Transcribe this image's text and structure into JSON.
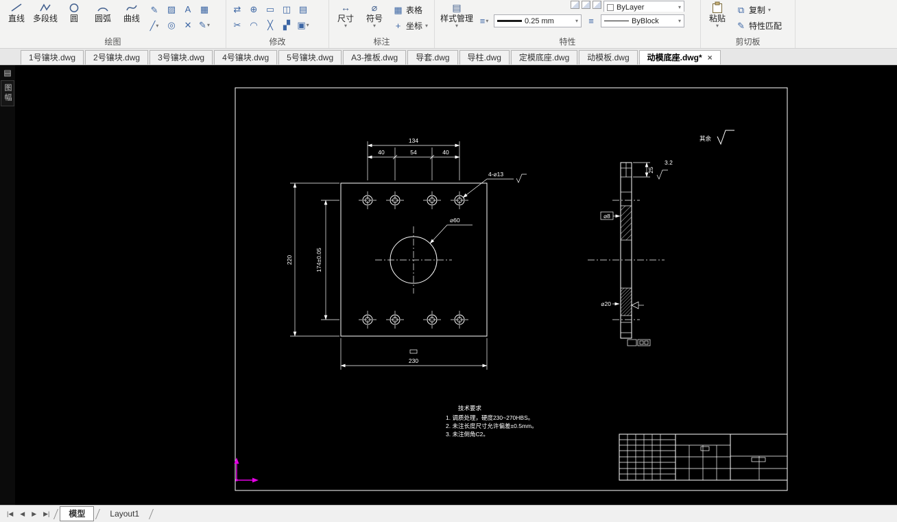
{
  "ribbon": {
    "draw": {
      "label": "绘图",
      "line": "直线",
      "polyline": "多段线",
      "circle": "圆",
      "arc": "圆弧",
      "spline": "曲线"
    },
    "modify": {
      "label": "修改"
    },
    "annotate": {
      "label": "标注",
      "dimension": "尺寸",
      "symbol": "符号",
      "table": "表格",
      "coordinate": "坐标"
    },
    "properties": {
      "label": "特性",
      "style_manager": "样式管理",
      "color": "ByLayer",
      "lineweight": "0.25 mm",
      "linetype": "ByBlock"
    },
    "clipboard": {
      "label": "剪切板",
      "paste": "粘贴",
      "copy": "复制",
      "match_properties": "特性匹配"
    }
  },
  "doc_tabs": {
    "close_glyph": "×",
    "items": [
      {
        "label": "1号镶块.dwg"
      },
      {
        "label": "2号镶块.dwg"
      },
      {
        "label": "3号镶块.dwg"
      },
      {
        "label": "4号镶块.dwg"
      },
      {
        "label": "5号镶块.dwg"
      },
      {
        "label": "A3-推板.dwg"
      },
      {
        "label": "导套.dwg"
      },
      {
        "label": "导柱.dwg"
      },
      {
        "label": "定模底座.dwg"
      },
      {
        "label": "动模板.dwg"
      },
      {
        "label": "动模底座.dwg*",
        "active": true
      }
    ]
  },
  "left_rail": {
    "panel_tab": "图幅"
  },
  "status": {
    "model_tab": "模型",
    "layout_tab": "Layout1",
    "nav": {
      "first": "|◀",
      "prev": "◀",
      "next": "▶",
      "last": "▶|"
    }
  },
  "drawing": {
    "surface_note_prefix": "其余",
    "notes_title": "技术要求",
    "notes": [
      "1. 调质处理，硬度230~270HBS。",
      "2. 未注长度尺寸允许偏差±0.5mm。",
      "3. 未注倒角C2。"
    ],
    "dimensions": {
      "top_overall": "134",
      "top_spacing_left": "40",
      "top_spacing_mid": "54",
      "top_spacing_right": "40",
      "left_overall": "220",
      "left_hole_spacing": "174±0.05",
      "bottom_overall": "230",
      "side_thickness": "25",
      "side_roughness": "3.2",
      "hole_callout": "4-⌀13",
      "center_bore": "⌀60",
      "side_upper_callout": "⌀8",
      "side_lower_callout": "⌀20"
    },
    "colors": {
      "line": "#ffffff",
      "ucs": "#e400e4",
      "background": "#000000"
    }
  }
}
